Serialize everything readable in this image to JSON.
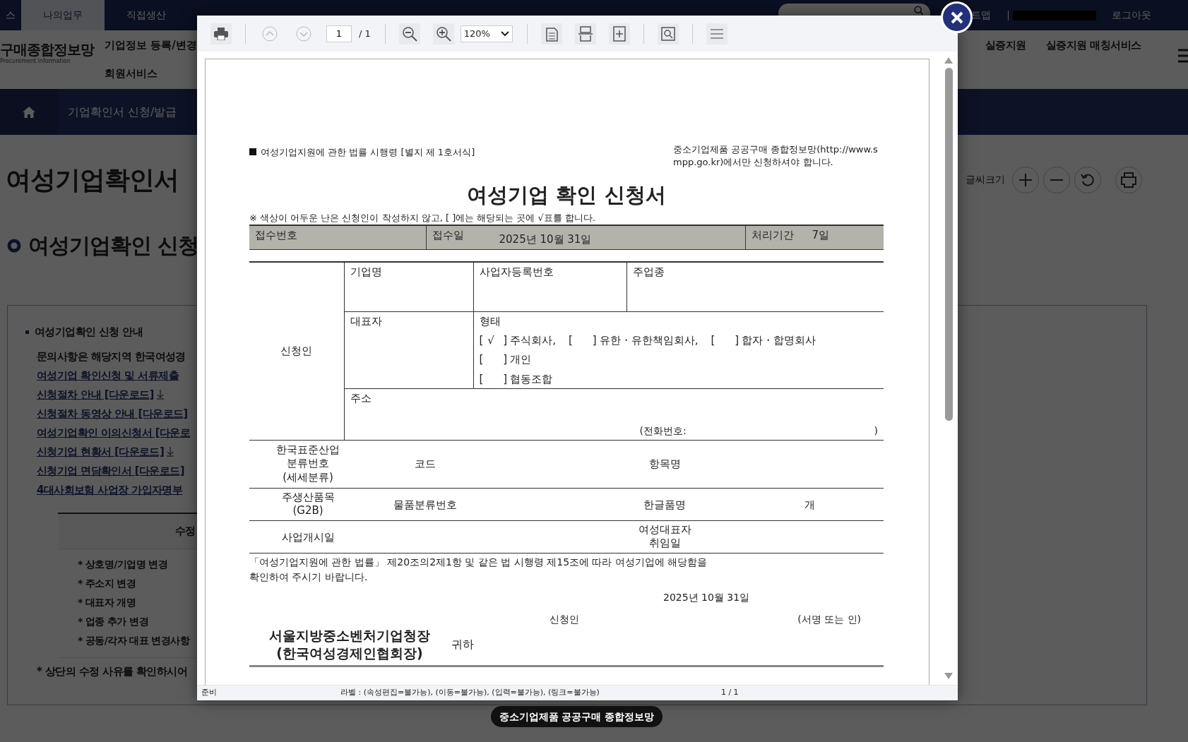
{
  "top_bar": {
    "cut_tab": "스",
    "tabs": [
      {
        "label": "나의업무",
        "selected": true
      },
      {
        "label": "직접생산",
        "selected": false
      }
    ],
    "sitemap": "트맵",
    "logout": "로그아웃"
  },
  "header": {
    "logo_title": "구매종합정보망",
    "logo_subtitle": "Procurement information",
    "menu_left": [
      "기업정보 등록/변경",
      "회원서비스"
    ],
    "menu_right": [
      "실증지원",
      "실증지원 매칭서비스"
    ]
  },
  "breadcrumb": "기업확인서 신청/발급",
  "page_title": "여성기업확인서",
  "font_size_label": "글씨크기",
  "section_title": "여성기업확인 신청",
  "guide": {
    "heading": "여성기업확인 신청 안내",
    "intro": "문의사항은 해당지역 한국여성경",
    "links": [
      {
        "text": "여성기업 확인신청 및 서류제출",
        "download": false
      },
      {
        "text": "신청절차 안내 [다운로드]",
        "download": true
      },
      {
        "text": "신청절차 동영상 안내 [다운로드]",
        "download": false
      },
      {
        "text": "여성기업확인 이의신청서 [다운로",
        "download": false
      },
      {
        "text": "신청기업 현황서 [다운로드]",
        "download": true
      },
      {
        "text": "신청기업 면담확인서 [다운로드]",
        "download": false
      },
      {
        "text": "4대사회보험 사업장 가입자명부",
        "download": false
      }
    ]
  },
  "revision_table": {
    "header": "수정",
    "items": [
      "* 상호명/기업명 변경",
      "* 주소지 변경",
      "* 대표자 개명",
      "* 업종 추가 변경",
      "* 공동/각자 대표 변경사항"
    ],
    "note": "* 상단의 수정 사유를 확인하시어"
  },
  "viewer": {
    "toolbar": {
      "nav_buttons": [
        {
          "disabled": true
        },
        {
          "disabled": true
        }
      ],
      "page": "1",
      "page_total": "/ 1",
      "zoom": "120%"
    },
    "document": {
      "form_ref": "여성기업지원에 관한 법률 시행령 [별지 제 1호서식]",
      "notice": "중소기업제품 공공구매 종합정보망(http://www.smpp.go.kr)에서만 신청하셔야 합니다.",
      "title": "여성기업 확인 신청서",
      "instruction": "※ 색상이 어두운 난은 신청인이 작성하지 않고, [ ]에는 해당되는 곳에 √표를 합니다.",
      "receipt": {
        "number_label": "접수번호",
        "date_label": "접수일",
        "date": "2025년 10월 31일",
        "period_label": "처리기간",
        "period": "7일"
      },
      "applicant": {
        "label": "신청인",
        "company": "기업명",
        "reg_no": "사업자등록번호",
        "industry": "주업종",
        "ceo": "대표자",
        "type_label": "형태",
        "bracket_open": "[",
        "bracket_close": "]",
        "check_mark": "√",
        "types": [
          {
            "label": "주식회사,",
            "checked": true
          },
          {
            "label": "유한・유한책임회사,",
            "checked": false
          },
          {
            "label": "합자・합명회사",
            "checked": false
          },
          {
            "label": "개인",
            "checked": false
          },
          {
            "label": "협동조합",
            "checked": false
          }
        ],
        "address": "주소",
        "phone_open": "(전화번호:",
        "phone_close": ")"
      },
      "industry_row": {
        "label_lines": [
          "한국표준산업",
          "분류번호",
          "(세세분류)"
        ],
        "code": "코드",
        "item_name": "항목명"
      },
      "product_row": {
        "label_lines": [
          "주생산품목",
          "(G2B)"
        ],
        "class_no": "물품분류번호",
        "korean_name": "한글품명",
        "count": "개"
      },
      "start_row": {
        "label": "사업개시일",
        "ceo_date_lines": [
          "여성대표자",
          "취임일"
        ]
      },
      "declaration": "「여성기업지원에 관한 법률」 제20조의2제1항 및 같은 법 시행령 제15조에 따라 여성기업에 해당함을 확인하여 주시기 바랍니다.",
      "date": "2025년 10월 31일",
      "applicant_label": "신청인",
      "sign": "(서명 또는 인)",
      "recipient_lines": [
        "서울지방중소벤처기업청장",
        "(한국여성경제인협회장)"
      ],
      "recipient_suffix": "귀하"
    },
    "status": {
      "state": "준비",
      "label": "라벨 : (속성편집=불가능), (이동=불가능), (입력=불가능), (링크=불가능)",
      "page": "1 / 1"
    }
  },
  "toast": "중소기업제품 공공구매 종합정보망"
}
